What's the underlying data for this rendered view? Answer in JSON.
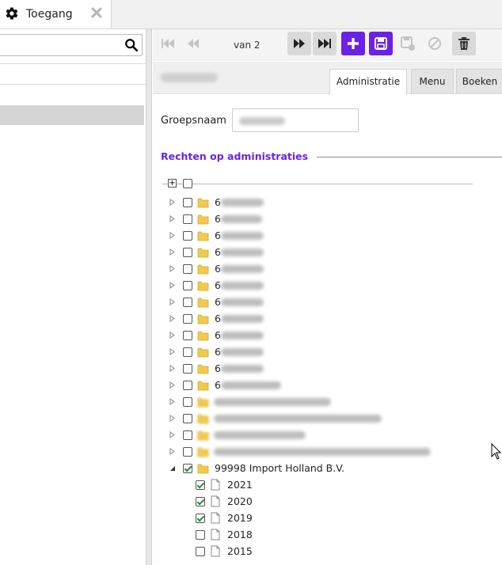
{
  "tab": {
    "title": "Toegang"
  },
  "search": {
    "placeholder": ""
  },
  "toolbar": {
    "page_text": "van 2"
  },
  "form_tabs": [
    "Administratie",
    "Menu",
    "Boeken"
  ],
  "form": {
    "group_name_label": "Groepsnaam",
    "group_name_value": ""
  },
  "section": {
    "title": "Rechten op administraties"
  },
  "tree": {
    "collapsed_rows": [
      {
        "prefix": "6",
        "checked": false
      },
      {
        "prefix": "6",
        "checked": false
      },
      {
        "prefix": "6",
        "checked": false
      },
      {
        "prefix": "6",
        "checked": false
      },
      {
        "prefix": "6",
        "checked": false
      },
      {
        "prefix": "6",
        "checked": false
      },
      {
        "prefix": "6",
        "checked": false
      },
      {
        "prefix": "6",
        "checked": false
      },
      {
        "prefix": "6",
        "checked": false
      },
      {
        "prefix": "6",
        "checked": false
      },
      {
        "prefix": "6",
        "checked": false
      },
      {
        "prefix": "6",
        "checked": false
      },
      {
        "prefix": "",
        "checked": false
      },
      {
        "prefix": "",
        "checked": false
      },
      {
        "prefix": "",
        "checked": false
      },
      {
        "prefix": "",
        "checked": false
      }
    ],
    "expanded": {
      "label": "99998 Import Holland B.V.",
      "checked": true,
      "years": [
        {
          "label": "2021",
          "checked": true
        },
        {
          "label": "2020",
          "checked": true
        },
        {
          "label": "2019",
          "checked": true
        },
        {
          "label": "2018",
          "checked": false
        },
        {
          "label": "2015",
          "checked": false
        }
      ]
    }
  },
  "colors": {
    "accent": "#6b22e6",
    "selected_row": "#d5d5d5"
  }
}
